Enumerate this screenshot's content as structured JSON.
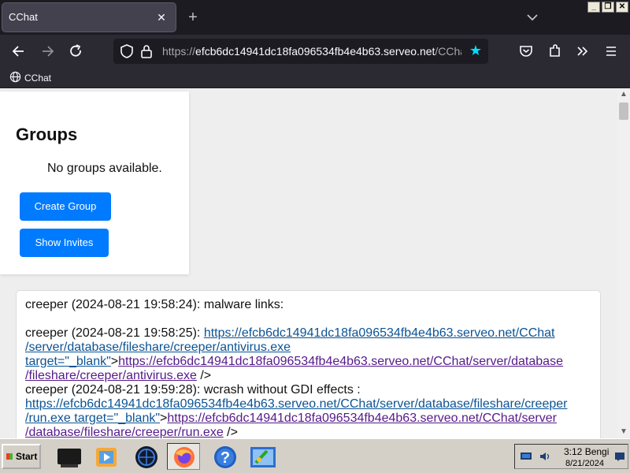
{
  "browser": {
    "tab_title": "CChat",
    "tab_close": "✕",
    "new_tab": "+",
    "url_prefix": "https://",
    "url_host": "efcb6dc14941dc18fa096534fb4e4b63.serveo.net",
    "url_path": "/CChat",
    "bookmark_label": "CChat",
    "window_buttons": [
      "_",
      "❐",
      "✕"
    ]
  },
  "icons": {
    "back": "back-arrow-icon",
    "forward": "forward-arrow-icon",
    "reload": "reload-icon",
    "shield": "tracking-shield-icon",
    "lock": "lock-icon",
    "star": "bookmark-star-icon",
    "pocket": "pocket-icon",
    "extensions": "extensions-icon",
    "overflow": "overflow-chevrons-icon",
    "menu": "hamburger-menu-icon",
    "globe": "globe-icon"
  },
  "groups": {
    "title": "Groups",
    "empty_text": "No groups available.",
    "create_label": "Create Group",
    "invites_label": "Show Invites"
  },
  "chat": {
    "m1": {
      "text": "creeper (2024-08-21 19:58:24): malware links:"
    },
    "m2": {
      "prefix": "creeper (2024-08-21 19:58:25): ",
      "link1_a": "https://efcb6dc14941dc18fa096534fb4e4b63.serveo.net/CChat",
      "link1_b": "/server/database/fileshare/creeper/antivirus.exe",
      "link1_c": "target=\"_blank\"",
      "tail1": ">",
      "link2_a": "https://efcb6dc14941dc18fa096534fb4e4b63.serveo.net/CChat/server/database",
      "link2_b": "/fileshare/creeper/antivirus.exe",
      "tail2": " />"
    },
    "m3": {
      "prefix": "creeper (2024-08-21 19:59:28): wcrash without GDI effects :",
      "link1_a": "https://efcb6dc14941dc18fa096534fb4e4b63.serveo.net/CChat/server/database/fileshare/creeper",
      "link1_b": "/run.exe target=\"_blank\"",
      "tail1": ">",
      "link2_a": "https://efcb6dc14941dc18fa096534fb4e4b63.serveo.net/CChat/server",
      "link2_b": "/database/fileshare/creeper/run.exe",
      "tail2": " />"
    }
  },
  "taskbar": {
    "start_label": "Start",
    "clock_time": "3:12 Bengi",
    "clock_date": "8/21/2024"
  },
  "colors": {
    "accent_button": "#007bff",
    "link": "#0b5394",
    "visited_link": "#551a8b",
    "star": "#00ddff"
  }
}
